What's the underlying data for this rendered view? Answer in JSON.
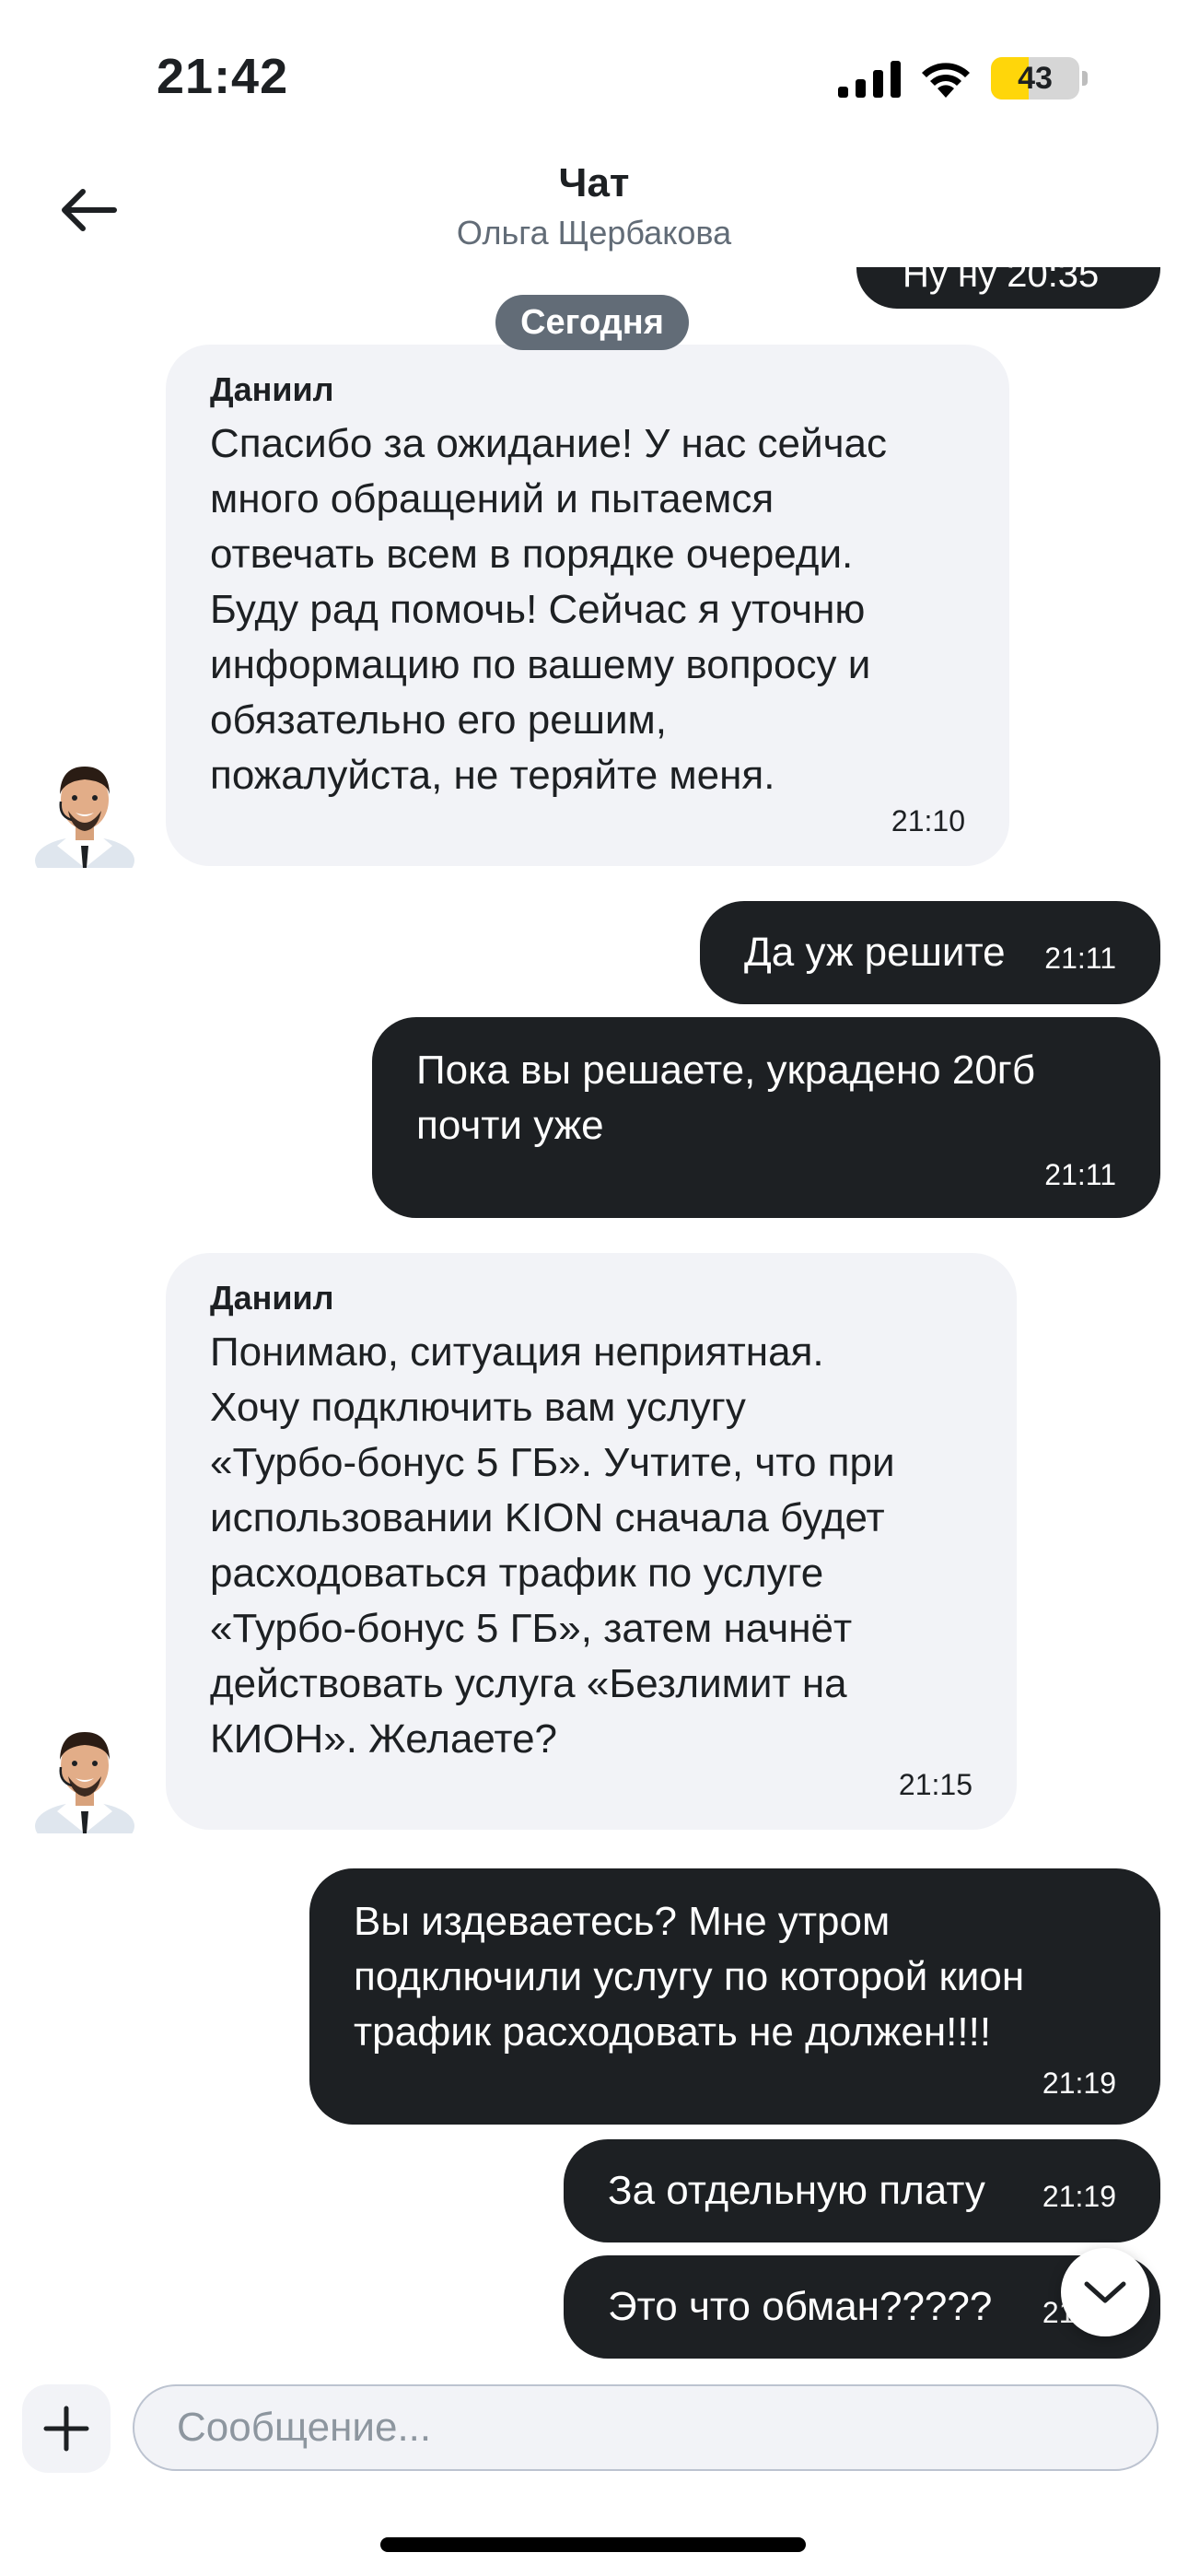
{
  "status_bar": {
    "time": "21:42",
    "battery_level": "43",
    "battery_fraction": 0.43
  },
  "header": {
    "title": "Чат",
    "subtitle": "Ольга Щербакова",
    "back_icon": "arrow-left-icon"
  },
  "chat": {
    "partial_top_message": "Ну ну  20:35",
    "date_separator": "Сегодня",
    "messages": [
      {
        "direction": "in",
        "sender": "Даниил",
        "text": "Спасибо за ожидание! У нас сейчас\nмного обращений и пытаемся\nотвечать всем в порядке очереди.\nБуду рад помочь! Сейчас я уточню\nинформацию по вашему вопросу и\nобязательно его решим,\nпожалуйста, не теряйте меня.",
        "time": "21:10"
      },
      {
        "direction": "out",
        "text": "Да уж решите",
        "time": "21:11"
      },
      {
        "direction": "out",
        "text": "Пока вы решаете, украдено 20гб\nпочти уже",
        "time": "21:11"
      },
      {
        "direction": "in",
        "sender": "Даниил",
        "text": "Понимаю, ситуация неприятная.\nХочу подключить вам услугу\n«Турбо-бонус 5 ГБ». Учтите, что при\nиспользовании KION сначала будет\nрасходоваться трафик по услуге\n«Турбо-бонус 5 ГБ», затем начнёт\nдействовать услуга «Безлимит на\nКИОН». Желаете?",
        "time": "21:15"
      },
      {
        "direction": "out",
        "text": "Вы издеваетесь? Мне утром\nподключили услугу по которой кион\nтрафик расходовать не должен!!!!",
        "time": "21:19"
      },
      {
        "direction": "out",
        "text": "За отдельную плату",
        "time": "21:19"
      },
      {
        "direction": "out",
        "text": "Это что обман?????",
        "time": "21:19"
      }
    ]
  },
  "composer": {
    "placeholder": "Сообщение..."
  },
  "colors": {
    "dark_bubble": "#1d2023",
    "light_bubble": "#f2f3f7",
    "date_pill": "#626c77",
    "battery": "#ffd60a"
  }
}
